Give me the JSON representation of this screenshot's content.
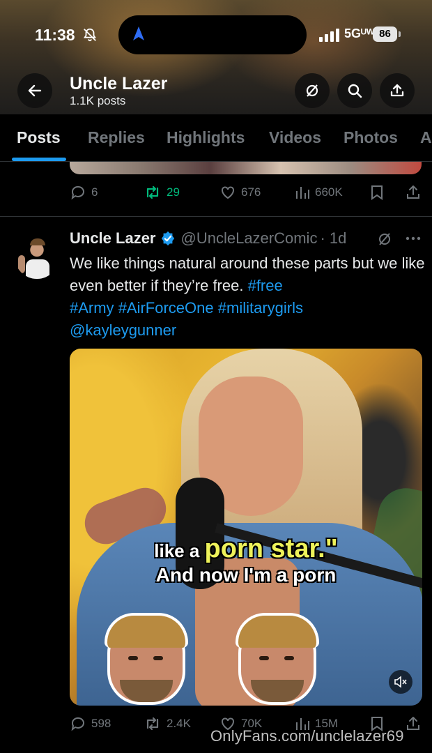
{
  "status_bar": {
    "time": "11:38",
    "network": "5Gᵁᵂ",
    "battery": "86",
    "icons": [
      "bell-slash-icon",
      "location-arrow-icon",
      "signal-icon"
    ]
  },
  "header": {
    "name": "Uncle Lazer",
    "post_count": "1.1K posts",
    "icons": [
      "back-arrow-icon",
      "mute-icon",
      "search-icon",
      "share-icon"
    ]
  },
  "tabs": [
    {
      "label": "Posts",
      "active": true
    },
    {
      "label": "Replies",
      "active": false
    },
    {
      "label": "Highlights",
      "active": false
    },
    {
      "label": "Videos",
      "active": false
    },
    {
      "label": "Photos",
      "active": false
    },
    {
      "label": "A",
      "active": false
    }
  ],
  "prev_post": {
    "replies": "6",
    "reposts": "29",
    "likes": "676",
    "views": "660K"
  },
  "post": {
    "name": "Uncle Lazer",
    "handle": "@UncleLazerComic",
    "time": "· 1d",
    "text_plain": "We like things natural around these parts but we like even better if they’re free. ",
    "hashtags": [
      "#free",
      "#Army",
      "#AirForceOne",
      "#militarygirls"
    ],
    "mention": "@kayleygunner",
    "media": {
      "caption_pre": "like a ",
      "caption_highlight": "porn star.\"",
      "caption_line2": "And now I'm a porn"
    },
    "replies": "598",
    "reposts": "2.4K",
    "likes": "70K",
    "views": "15M"
  },
  "colors": {
    "accent": "#1d9bf0",
    "repost_green": "#00ba7c",
    "muted_text": "#71767b",
    "caption_yellow": "#eef25a"
  },
  "watermark": "OnlyFans.com/unclelazer69"
}
